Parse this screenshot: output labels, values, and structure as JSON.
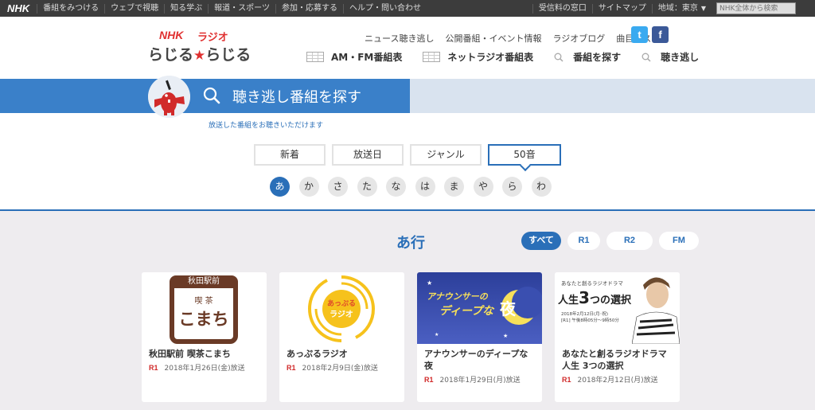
{
  "topbar": {
    "logo": "NHK",
    "links": [
      "番組をみつける",
      "ウェブで視聴",
      "知る学ぶ",
      "報道・スポーツ",
      "参加・応募する",
      "ヘルプ・問い合わせ"
    ],
    "right_links": [
      "受信料の窓口",
      "サイトマップ"
    ],
    "region": "地域：東京",
    "search_placeholder": "NHK全体から検索"
  },
  "brand": {
    "nhk": "NHK",
    "radio": "ラジオ",
    "rajiru_a": "らじる",
    "star": "★",
    "rajiru_b": "らじる"
  },
  "header_links": [
    "ニュース聴き逃し",
    "公開番組・イベント情報",
    "ラジオブログ",
    "曲目リスト"
  ],
  "social": {
    "twitter": "t",
    "facebook": "f"
  },
  "header_nav": [
    "AM・FM番組表",
    "ネットラジオ番組表",
    "番組を探す",
    "聴き逃し"
  ],
  "hero": {
    "title": "聴き逃し番組を探す",
    "subtitle": "放送した番組をお聴きいただけます"
  },
  "tabs": [
    "新着",
    "放送日",
    "ジャンル",
    "50音"
  ],
  "kana": [
    "あ",
    "か",
    "さ",
    "た",
    "な",
    "は",
    "ま",
    "や",
    "ら",
    "わ"
  ],
  "section_title": "あ行",
  "filters": [
    "すべて",
    "R1",
    "R2",
    "FM"
  ],
  "cards": [
    {
      "title": "秋田駅前 喫茶こまち",
      "channel": "R1",
      "date": "2018年1月26日(金)放送",
      "thumb": {
        "line1": "秋田駅前",
        "line2": "喫 茶",
        "line3": "こまち"
      }
    },
    {
      "title": "あっぷるラジオ",
      "channel": "R1",
      "date": "2018年2月9日(金)放送",
      "thumb": {
        "line1": "あっぷる",
        "line2": "ラジオ"
      }
    },
    {
      "title": "アナウンサーのディープな夜",
      "channel": "R1",
      "date": "2018年1月29日(月)放送",
      "thumb": {
        "line1": "アナウンサーの",
        "line2": "ディープな",
        "line3": "夜"
      }
    },
    {
      "title": "あなたと創るラジオドラマ 人生 3つの選択",
      "channel": "R1",
      "date": "2018年2月12日(月)放送",
      "thumb": {
        "line1": "あなたと創るラジオドラマ",
        "line2": "人生",
        "line3": "3",
        "line4": "つの選択",
        "line5": "2018年2月12日(月･祝)",
        "line6": "[R1] 午後8時05分～9時50分"
      }
    }
  ],
  "colors": {
    "accent": "#2a6fb8",
    "hero_blue": "#3a80c9",
    "brand_red": "#e03030",
    "topbar": "#3c3c3c",
    "content_bg": "#eeecef"
  }
}
